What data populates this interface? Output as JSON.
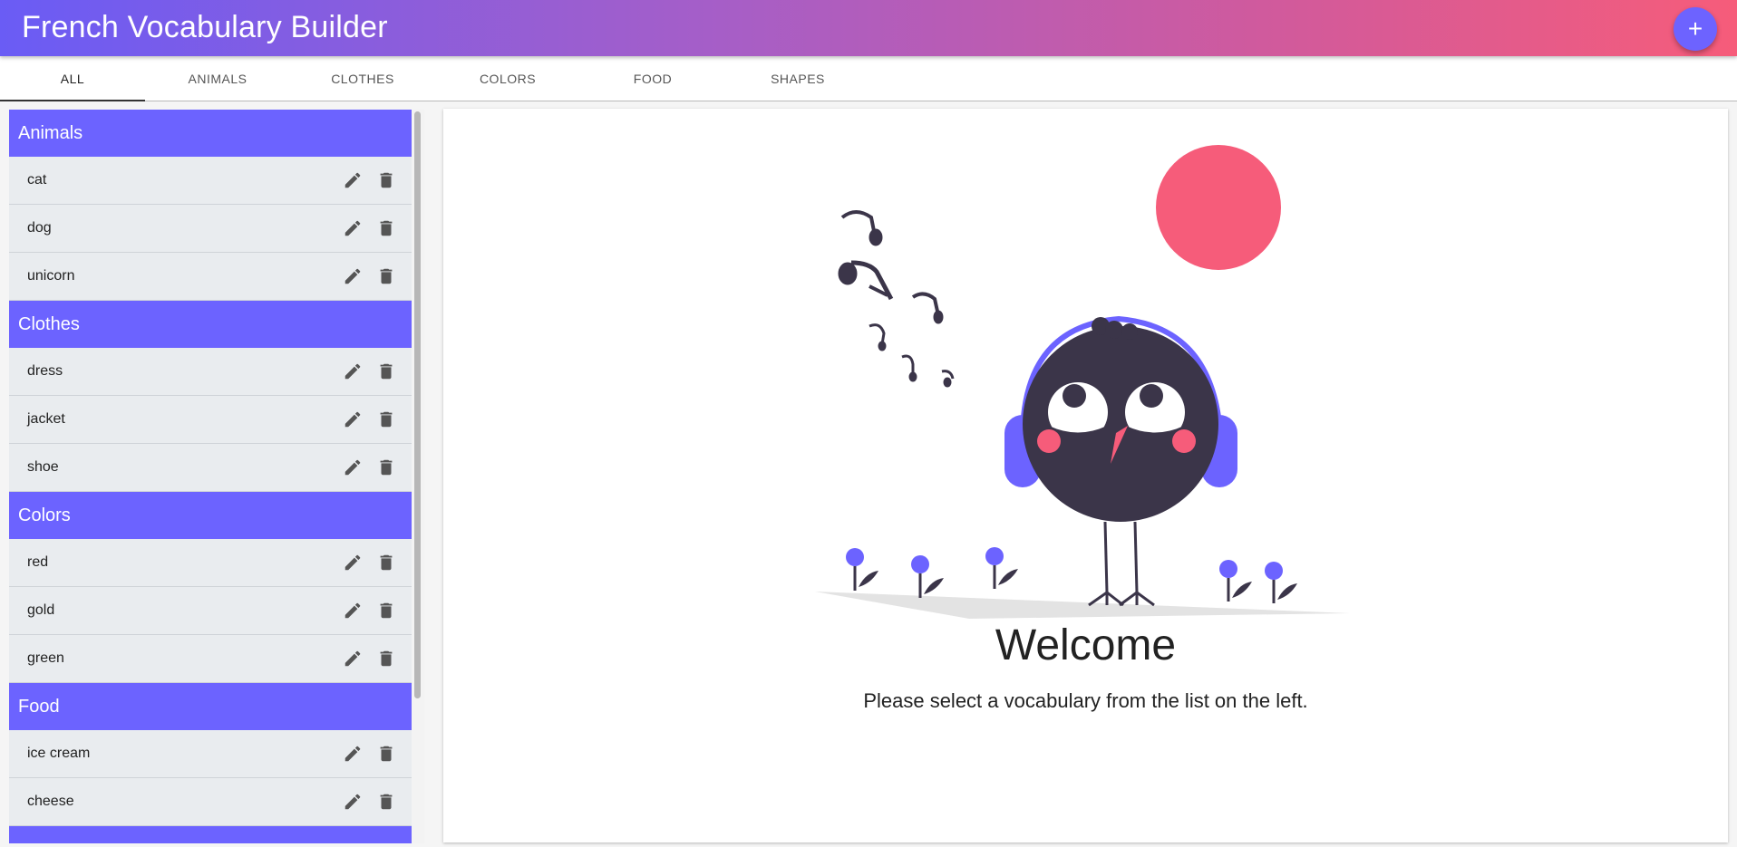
{
  "app": {
    "title": "French Vocabulary Builder",
    "add_button_label": "+"
  },
  "tabs": [
    {
      "label": "ALL"
    },
    {
      "label": "ANIMALS"
    },
    {
      "label": "CLOTHES"
    },
    {
      "label": "COLORS"
    },
    {
      "label": "FOOD"
    },
    {
      "label": "SHAPES"
    }
  ],
  "active_tab": "ALL",
  "sidebar": {
    "groups": [
      {
        "name": "Animals",
        "words": [
          "cat",
          "dog",
          "unicorn"
        ]
      },
      {
        "name": "Clothes",
        "words": [
          "dress",
          "jacket",
          "shoe"
        ]
      },
      {
        "name": "Colors",
        "words": [
          "red",
          "gold",
          "green"
        ]
      },
      {
        "name": "Food",
        "words": [
          "ice cream",
          "cheese"
        ]
      }
    ],
    "row_icons": [
      "pencil-icon",
      "trash-icon"
    ]
  },
  "main": {
    "title": "Welcome",
    "message": "Please select a vocabulary from the list on the left."
  },
  "colors": {
    "accent": "#6c63ff",
    "pink": "#f65c7a",
    "dark": "#3b3549",
    "row_bg": "#e9ecef"
  }
}
